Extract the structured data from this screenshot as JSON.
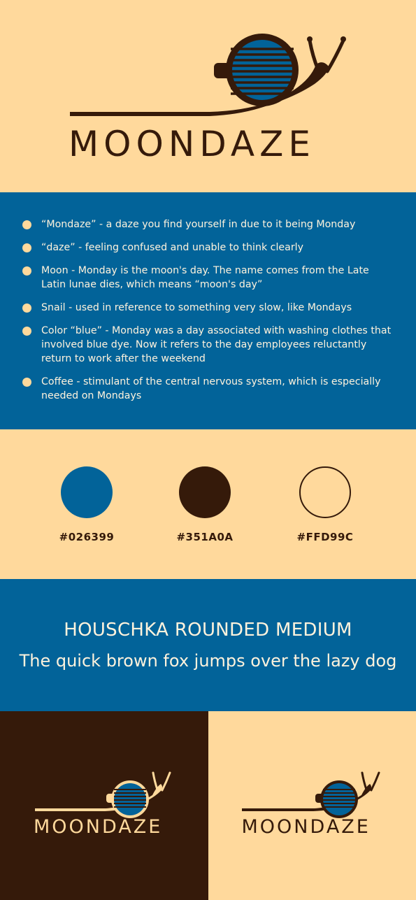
{
  "brand": {
    "logo_text": "MOONDAZE"
  },
  "bullets": [
    {
      "text": "“Mondaze” - a daze you find yourself in due to it being Monday"
    },
    {
      "text": "“daze” - feeling confused and unable to think clearly"
    },
    {
      "text": "Moon - Monday is the moon's day. The name comes from the Late Latin lunae dies, which means “moon's day”"
    },
    {
      "text": "Snail - used in reference to something very slow, like Mondays"
    },
    {
      "text": "Color “blue” - Monday was a day associated with washing clothes that involved blue dye. Now it refers to the day employees reluctantly return to work after the weekend"
    },
    {
      "text": "Coffee - stimulant of the central nervous system, which is especially needed on Mondays"
    }
  ],
  "palette": [
    {
      "hex": "#026399",
      "label": "#026399"
    },
    {
      "hex": "#351A0A",
      "label": "#351A0A"
    },
    {
      "hex": "#FFD99C",
      "label": "#FFD99C"
    }
  ],
  "typography": {
    "font_name": "HOUSCHKA ROUNDED MEDIUM",
    "pangram": "The quick brown fox jumps over the lazy dog"
  },
  "colors": {
    "blue": "#026399",
    "brown": "#351A0A",
    "cream": "#FFD99C"
  }
}
